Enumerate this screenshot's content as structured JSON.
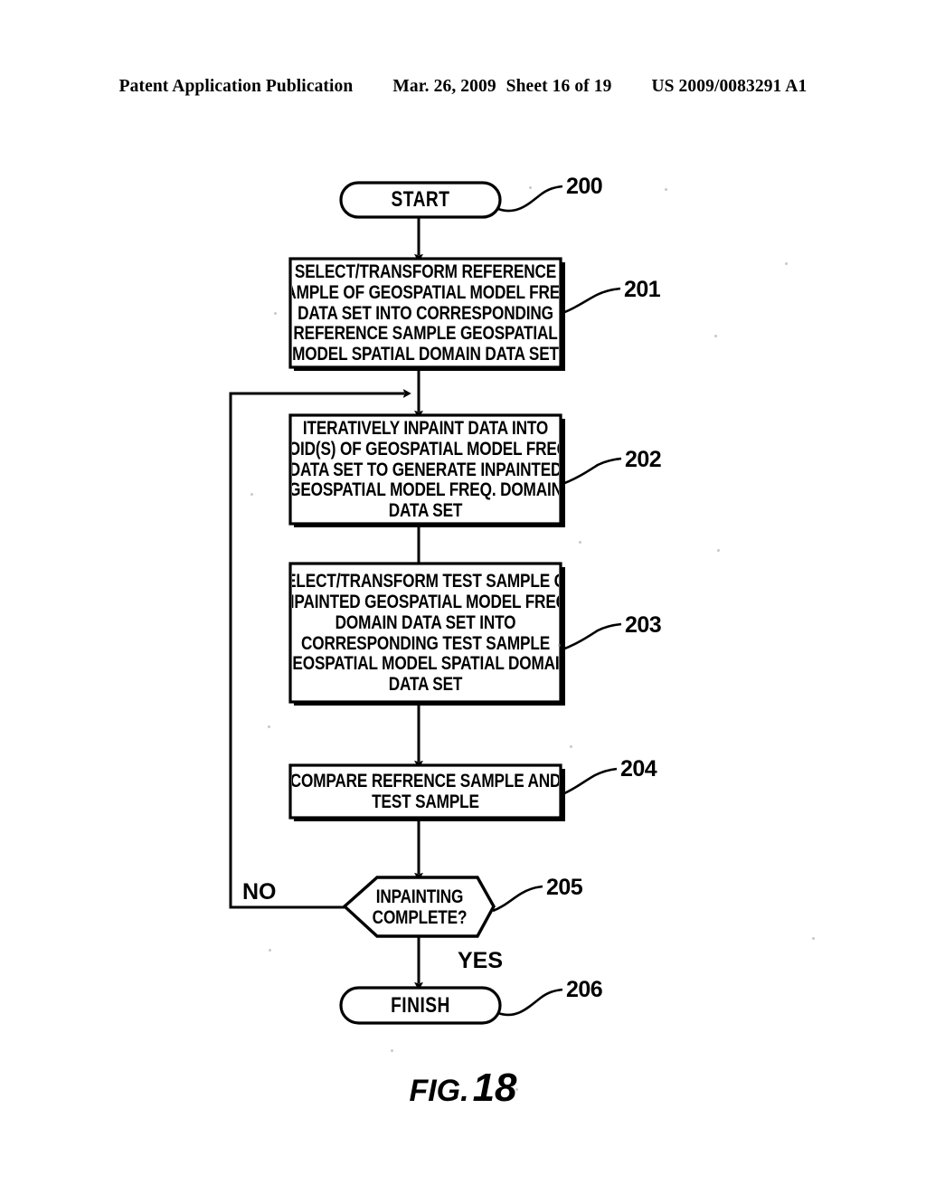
{
  "header": {
    "publication": "Patent Application Publication",
    "date": "Mar. 26, 2009",
    "sheet": "Sheet 16 of 19",
    "patent_number": "US 2009/0083291 A1"
  },
  "figure": {
    "caption_word": "FIG.",
    "caption_number": "18"
  },
  "flowchart": {
    "nodes": [
      {
        "id": "start",
        "type": "terminator",
        "ref": "200",
        "lines": [
          "START"
        ]
      },
      {
        "id": "step201",
        "type": "process",
        "ref": "201",
        "lines": [
          "SELECT/TRANSFORM REFERENCE",
          "SAMPLE OF GEOSPATIAL MODEL FREQ.",
          "DATA SET INTO CORRESPONDING",
          "REFERENCE SAMPLE GEOSPATIAL",
          "MODEL SPATIAL DOMAIN DATA SET"
        ]
      },
      {
        "id": "step202",
        "type": "process",
        "ref": "202",
        "lines": [
          "ITERATIVELY INPAINT DATA INTO",
          "VOID(S) OF GEOSPATIAL MODEL FREQ.",
          "DATA SET TO GENERATE INPAINTED",
          "GEOSPATIAL MODEL FREQ. DOMAIN",
          "DATA SET"
        ]
      },
      {
        "id": "step203",
        "type": "process",
        "ref": "203",
        "lines": [
          "SELECT/TRANSFORM TEST SAMPLE OF",
          "INPAINTED GEOSPATIAL MODEL FREQ.",
          "DOMAIN DATA SET INTO",
          "CORRESPONDING TEST SAMPLE",
          "GEOSPATIAL MODEL SPATIAL DOMAIN",
          "DATA SET"
        ]
      },
      {
        "id": "step204",
        "type": "process",
        "ref": "204",
        "lines": [
          "COMPARE REFRENCE SAMPLE AND",
          "TEST SAMPLE"
        ]
      },
      {
        "id": "decision205",
        "type": "decision",
        "ref": "205",
        "lines": [
          "INPAINTING",
          "COMPLETE?"
        ]
      },
      {
        "id": "finish",
        "type": "terminator",
        "ref": "206",
        "lines": [
          "FINISH"
        ]
      }
    ],
    "branch_labels": {
      "no": "NO",
      "yes": "YES"
    }
  }
}
